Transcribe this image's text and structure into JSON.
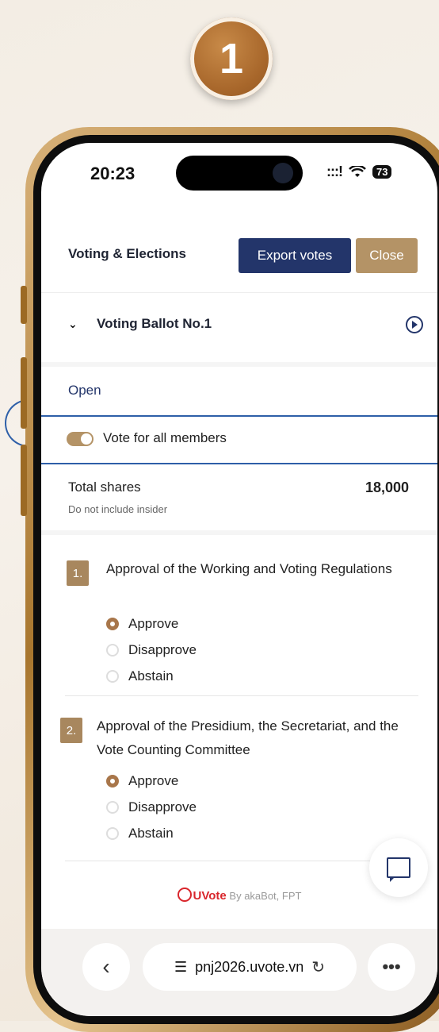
{
  "step_badge": "1",
  "status_bar": {
    "time": "20:23",
    "signal": ":::!",
    "wifi": "wifi-icon",
    "battery": "73"
  },
  "header": {
    "title": "Voting & Elections",
    "export_label": "Export votes",
    "close_label": "Close"
  },
  "ballot": {
    "title": "Voting Ballot No.1",
    "status": "Open",
    "vote_all_label": "Vote for all members"
  },
  "shares": {
    "label": "Total shares",
    "note": "Do not include insider",
    "value": "18,000"
  },
  "questions": [
    {
      "num": "1.",
      "text": "Approval of the Working and Voting Regulations",
      "options": [
        "Approve",
        "Disapprove",
        "Abstain"
      ],
      "selected": 0
    },
    {
      "num": "2.",
      "text": "Approval of the Presidium, the Secretariat, and the Vote Counting Committee",
      "options": [
        "Approve",
        "Disapprove",
        "Abstain"
      ],
      "selected": 0
    }
  ],
  "footer": {
    "brand": "UVote",
    "by": "By akaBot, FPT"
  },
  "browser": {
    "url": "pnj2026.uvote.vn",
    "back": "‹",
    "more": "•••"
  },
  "colors": {
    "navy": "#23356a",
    "gold": "#b49366",
    "brand_red": "#d9262c"
  }
}
